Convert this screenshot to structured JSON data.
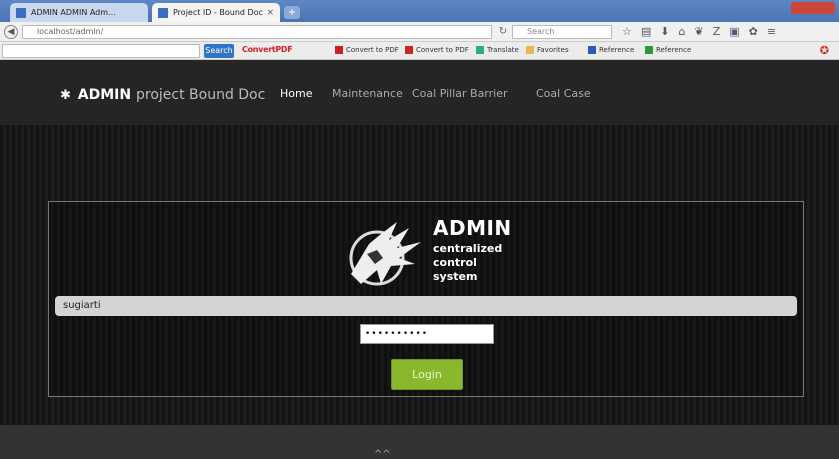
{
  "browser": {
    "tabs": [
      {
        "label": "ADMIN ADMIN Adm..."
      },
      {
        "label": "Project ID - Bound Doc"
      }
    ],
    "new_tab_label": "+",
    "url": "localhost/admin/",
    "search_placeholder": "Search"
  },
  "toolbar": {
    "search_button": "Search",
    "brand": "ConvertPDF",
    "brand_tail": "",
    "bookmarks": [
      "Convert to PDF",
      "Convert to PDF",
      "Translate",
      "Favorites",
      "Reference",
      "Reference"
    ]
  },
  "sitenav": {
    "brand_main": "ADMIN",
    "brand_sub": "project Bound Doc",
    "items": [
      "Home",
      "Maintenance",
      "Coal Pillar Barrier",
      "Coal Case"
    ]
  },
  "logo": {
    "title": "ADMIN",
    "line1": "centralized",
    "line2": "control",
    "line3": "system"
  },
  "login": {
    "username": "sugiarti",
    "password_mask": "••••••••••",
    "button": "Login"
  },
  "footer": {
    "mark": "^^"
  }
}
